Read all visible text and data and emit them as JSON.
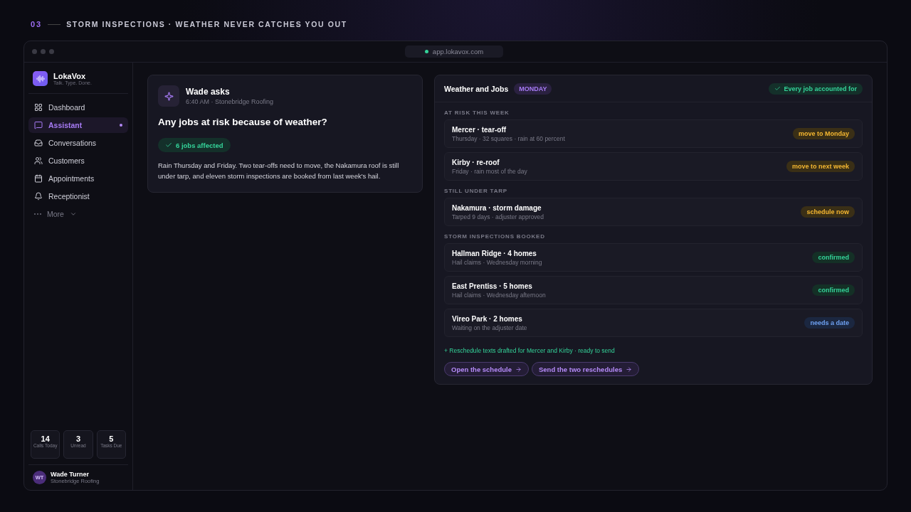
{
  "header": {
    "number": "03",
    "title": "STORM INSPECTIONS · WEATHER NEVER CATCHES YOU OUT"
  },
  "browser": {
    "url": "app.lokavox.com"
  },
  "sidebar": {
    "brand": {
      "name": "LokaVox",
      "tagline": "Talk. Type. Done."
    },
    "items": [
      {
        "label": "Dashboard",
        "selected": false,
        "kind": "link"
      },
      {
        "label": "Assistant",
        "selected": true,
        "kind": "link"
      },
      {
        "label": "Conversations",
        "selected": false,
        "kind": "link"
      },
      {
        "label": "Customers",
        "selected": false,
        "kind": "link"
      },
      {
        "label": "Appointments",
        "selected": false,
        "kind": "link"
      },
      {
        "label": "Receptionist",
        "selected": false,
        "kind": "link"
      },
      {
        "label": "More",
        "selected": false,
        "kind": "more"
      }
    ],
    "stats": [
      {
        "value": "14",
        "label": "Calls Today"
      },
      {
        "value": "3",
        "label": "Unread"
      },
      {
        "value": "5",
        "label": "Tasks Due"
      }
    ],
    "user": {
      "initials": "WT",
      "name": "Wade Turner",
      "company": "Stonebridge Roofing"
    }
  },
  "question": {
    "asker": "Wade asks",
    "meta": "6:40 AM · Stonebridge Roofing",
    "title": "Any jobs at risk because of weather?",
    "badge": "6 jobs affected",
    "body": "Rain Thursday and Friday. Two tear-offs need to move, the Nakamura roof is still under tarp, and eleven storm inspections are booked from last week's hail."
  },
  "panel": {
    "title": "Weather and Jobs",
    "day": "MONDAY",
    "status": "Every job accounted for",
    "sections": [
      {
        "heading": "AT RISK THIS WEEK",
        "rows": [
          {
            "title": "Mercer · tear-off",
            "detail": "Thursday · 32 squares · rain at 60 percent",
            "tag": "move to Monday",
            "kind": "warn"
          },
          {
            "title": "Kirby · re-roof",
            "detail": "Friday · rain most of the day",
            "tag": "move to next week",
            "kind": "warn"
          }
        ]
      },
      {
        "heading": "STILL UNDER TARP",
        "rows": [
          {
            "title": "Nakamura · storm damage",
            "detail": "Tarped 9 days · adjuster approved",
            "tag": "schedule now",
            "kind": "warn"
          }
        ]
      },
      {
        "heading": "STORM INSPECTIONS BOOKED",
        "rows": [
          {
            "title": "Hallman Ridge · 4 homes",
            "detail": "Hail claims · Wednesday morning",
            "tag": "confirmed",
            "kind": "ok"
          },
          {
            "title": "East Prentiss · 5 homes",
            "detail": "Hail claims · Wednesday afternoon",
            "tag": "confirmed",
            "kind": "ok"
          },
          {
            "title": "Vireo Park · 2 homes",
            "detail": "Waiting on the adjuster date",
            "tag": "needs a date",
            "kind": "info"
          }
        ]
      }
    ],
    "note": "+ Reschedule texts drafted for Mercer and Kirby · ready to send",
    "actions": [
      "Open the schedule",
      "Send the two reschedules"
    ]
  }
}
